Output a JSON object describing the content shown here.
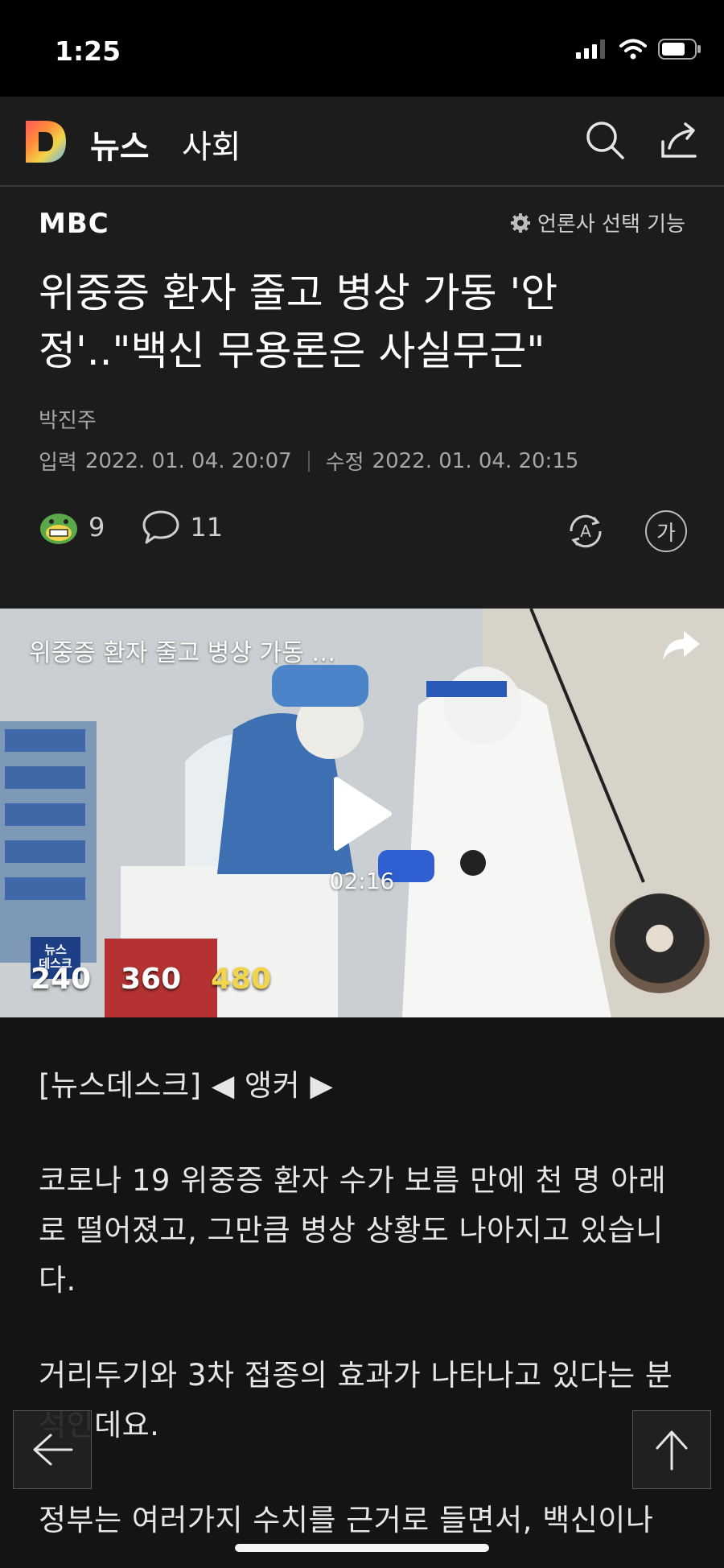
{
  "status_bar": {
    "time": "1:25"
  },
  "header": {
    "section": "뉴스",
    "subsection": "사회"
  },
  "article": {
    "press": "MBC",
    "press_select": "언론사 선택 기능",
    "headline_line1": "위중증 환자 줄고 병상 가동 '안",
    "headline_line2": "정'..\"백신 무용론은 사실무근\"",
    "author": "박진주",
    "input_label": "입력",
    "input_date": "2022. 01. 04. 20:07",
    "modified_label": "수정",
    "modified_date": "2022. 01. 04. 20:15",
    "reaction_count": "9",
    "comment_count": "11",
    "font_button": "가"
  },
  "video": {
    "title": "위중증 환자 줄고 병상 가동 …",
    "duration": "02:16",
    "badge_line1": "뉴스",
    "badge_line2": "데스크",
    "quality_options": [
      "240",
      "360",
      "480"
    ]
  },
  "body": {
    "paragraphs": [
      "[뉴스데스크] ◀ 앵커 ▶",
      "코로나 19 위중증 환자 수가 보름 만에 천 명 아래로 떨어졌고, 그만큼 병상 상황도 나아지고 있습니다.",
      "거리두기와 3차 접종의 효과가 나타나고 있다는 분석인데요.",
      "정부는 여러가지 수치를 근거로 들면서, 백신이나"
    ]
  },
  "colors": {
    "accent_yellow": "#f2d54a",
    "background": "#141414"
  }
}
